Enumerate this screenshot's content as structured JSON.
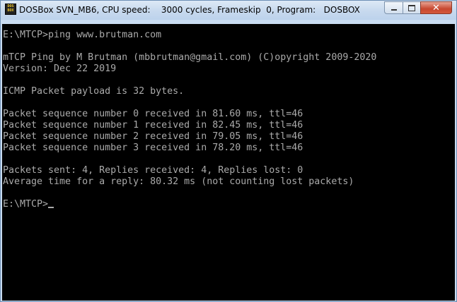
{
  "window": {
    "title": "DOSBox SVN_MB6, CPU speed:    3000 cycles, Frameskip  0, Program:   DOSBOX",
    "icon": "dosbox-icon",
    "icon_text_top": "DOS",
    "icon_text_bottom": "BOX",
    "buttons": {
      "minimize": "minimize-icon",
      "maximize": "maximize-icon",
      "close": "close-icon",
      "close_glyph": "✕"
    }
  },
  "terminal": {
    "lines": [
      "E:\\MTCP>ping www.brutman.com",
      "",
      "mTCP Ping by M Brutman (mbbrutman@gmail.com) (C)opyright 2009-2020",
      "Version: Dec 22 2019",
      "",
      "ICMP Packet payload is 32 bytes.",
      "",
      "Packet sequence number 0 received in 81.60 ms, ttl=46",
      "Packet sequence number 1 received in 82.45 ms, ttl=46",
      "Packet sequence number 2 received in 79.05 ms, ttl=46",
      "Packet sequence number 3 received in 78.20 ms, ttl=46",
      "",
      "Packets sent: 4, Replies received: 4, Replies lost: 0",
      "Average time for a reply: 80.32 ms (not counting lost packets)",
      "",
      "E:\\MTCP>"
    ],
    "text_color": "#aaaaaa",
    "background_color": "#000000"
  }
}
